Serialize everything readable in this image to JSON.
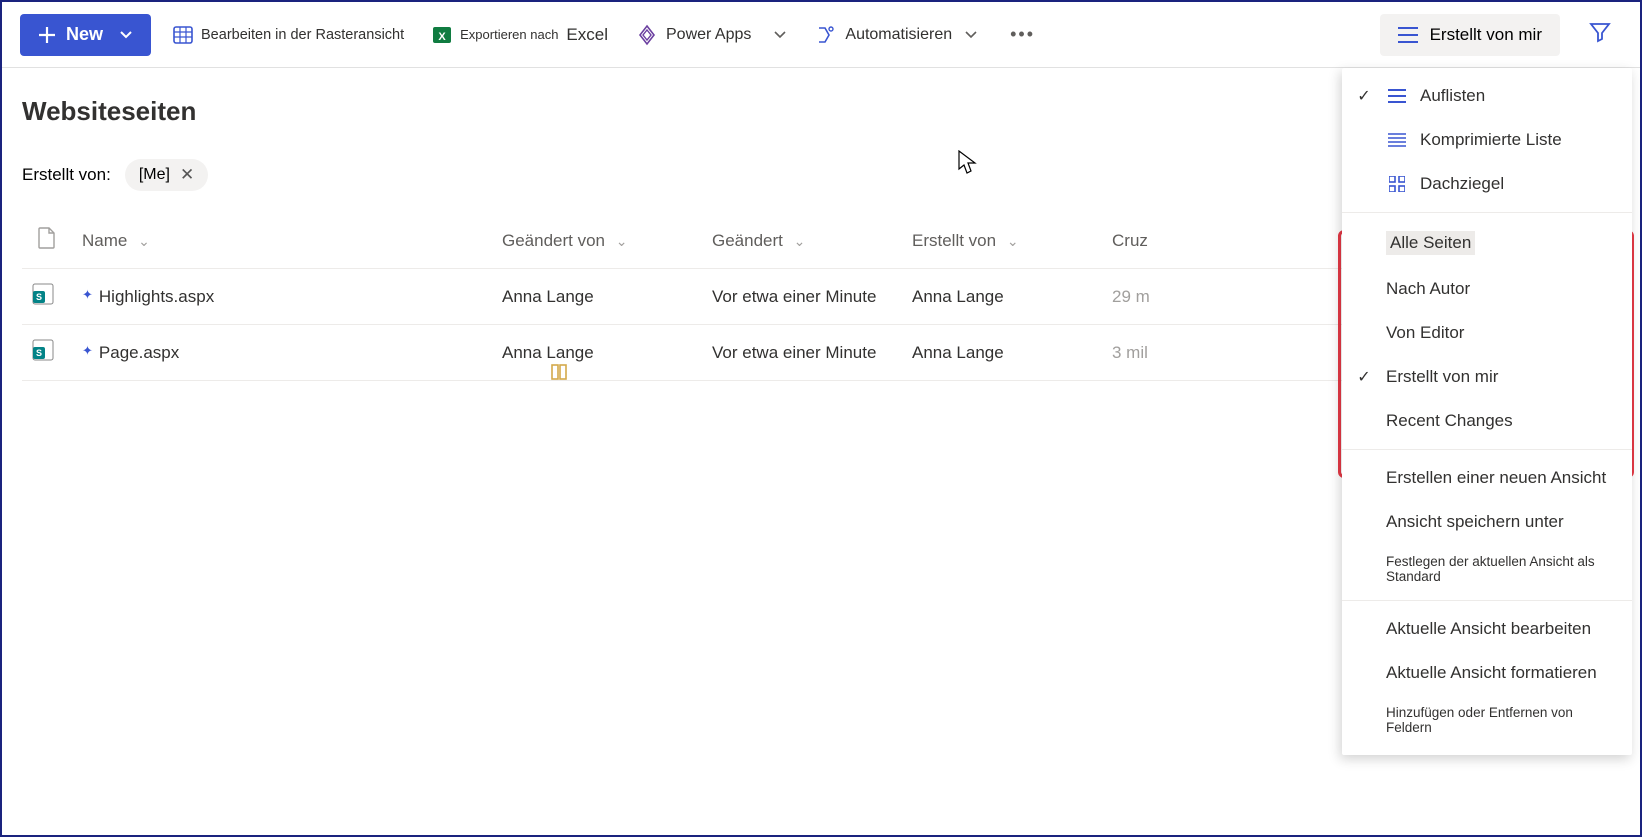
{
  "toolbar": {
    "new_label": "New",
    "grid_edit": "Bearbeiten in der Rasteransicht",
    "export": "Exportieren nach",
    "excel": "Excel",
    "power_apps": "Power Apps",
    "automate": "Automatisieren"
  },
  "view_switch": {
    "label": "Erstellt von mir"
  },
  "page": {
    "title": "Websiteseiten"
  },
  "filter": {
    "label": "Erstellt von:",
    "chip_value": "[Me]"
  },
  "columns": {
    "name": "Name",
    "modified_by": "Geändert von",
    "modified": "Geändert",
    "created_by": "Erstellt von",
    "cruz": "Cruz"
  },
  "rows": [
    {
      "name": "Highlights.aspx",
      "modified_by": "Anna Lange",
      "modified": "Vor etwa einer Minute",
      "created_by": "Anna Lange",
      "extra": "29 m",
      "flagged": false
    },
    {
      "name": "Page.aspx",
      "modified_by": "Anna Lange",
      "modified": "Vor etwa einer Minute",
      "created_by": "Anna Lange",
      "extra": "3 mil",
      "flagged": true
    }
  ],
  "menu": {
    "list": "Auflisten",
    "compact": "Komprimierte Liste",
    "tiles": "Dachziegel",
    "views": [
      "Alle Seiten",
      "Nach Autor",
      "Von Editor",
      "Erstellt von mir",
      "Recent Changes"
    ],
    "selected_view_index": 3,
    "create_view": "Erstellen einer neuen Ansicht",
    "save_as": "Ansicht speichern unter",
    "set_default": "Festlegen der aktuellen Ansicht als Standard",
    "edit_view": "Aktuelle Ansicht bearbeiten",
    "format_view": "Aktuelle Ansicht formatieren",
    "add_remove": "Hinzufügen oder Entfernen von Feldern"
  }
}
